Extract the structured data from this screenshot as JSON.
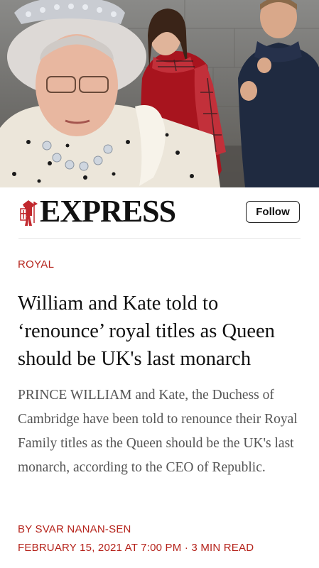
{
  "header": {
    "brand": "EXPRESS",
    "follow_label": "Follow"
  },
  "article": {
    "category": "ROYAL",
    "headline": "William and Kate told to ‘renounce’ royal titles as Queen should be UK's last monarch",
    "standfirst": "PRINCE WILLIAM and Kate, the Duchess of Cambridge have been told to renounce their Royal Family titles as the Queen should be the UK's last monarch, according to the CEO of Republic.",
    "byline": "BY SVAR NANAN-SEN",
    "date": "FEBRUARY 15, 2021 AT 7:00 PM",
    "separator": "·",
    "read_time": "3 MIN READ"
  },
  "colors": {
    "accent": "#b5231b",
    "headline": "#111111",
    "body": "#555555"
  },
  "icons": {
    "logo": "crusader-knight-logo-icon"
  }
}
